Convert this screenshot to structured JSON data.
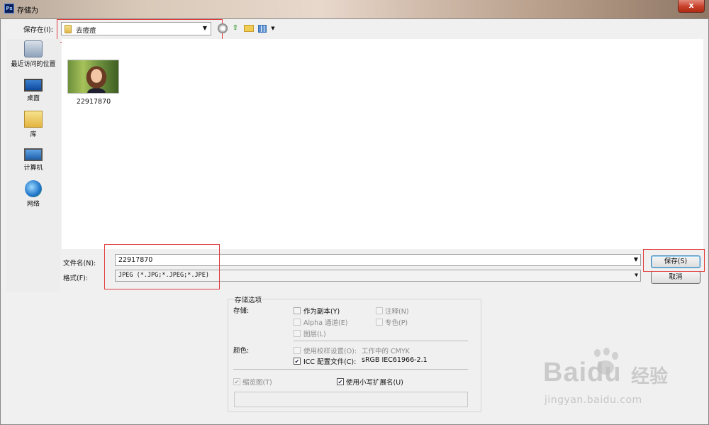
{
  "window": {
    "title": "存储为",
    "app_icon_text": "Ps",
    "close_glyph": "x"
  },
  "toolbar": {
    "save_in_label": "保存在(I):",
    "save_in_value": "去痘痘",
    "dropdown_glyph": "▼",
    "icons": [
      "back-icon",
      "up-folder-icon",
      "new-folder-icon",
      "view-menu-icon"
    ]
  },
  "places": [
    {
      "label": "最近访问的位置",
      "icon": "recent-places-icon"
    },
    {
      "label": "桌面",
      "icon": "desktop-icon"
    },
    {
      "label": "库",
      "icon": "library-icon"
    },
    {
      "label": "计算机",
      "icon": "computer-icon"
    },
    {
      "label": "网络",
      "icon": "network-icon"
    }
  ],
  "files": [
    {
      "name": "22917870",
      "icon": "image-thumbnail"
    }
  ],
  "filename": {
    "label": "文件名(N):",
    "value": "22917870"
  },
  "format": {
    "label": "格式(F):",
    "value": "JPEG (*.JPG;*.JPEG;*.JPE)"
  },
  "buttons": {
    "save": "保存(S)",
    "cancel": "取消"
  },
  "options": {
    "group_title": "存储选项",
    "storage_label": "存储:",
    "as_copy": {
      "label": "作为副本(Y)",
      "checked": false
    },
    "notes": {
      "label": "注释(N)",
      "checked": false
    },
    "alpha": {
      "label": "Alpha 通道(E)",
      "checked": false
    },
    "spot": {
      "label": "专色(P)",
      "checked": false
    },
    "layers": {
      "label": "图层(L)",
      "checked": false
    },
    "color_label": "颜色:",
    "proof": {
      "label": "使用校样设置(O):",
      "detail": "工作中的 CMYK",
      "checked": false
    },
    "icc": {
      "label": "ICC 配置文件(C):",
      "detail": "sRGB IEC61966-2.1",
      "checked": true
    },
    "thumbnail": {
      "label": "缩览图(T)",
      "checked": true
    },
    "lowercase_ext": {
      "label": "使用小写扩展名(U)",
      "checked": true
    }
  },
  "watermark": {
    "brand": "Baidu",
    "cn": "经验",
    "url": "jingyan.baidu.com"
  },
  "colors": {
    "highlight_box": "#e23b3b",
    "window_bg": "#f0f0f0"
  }
}
